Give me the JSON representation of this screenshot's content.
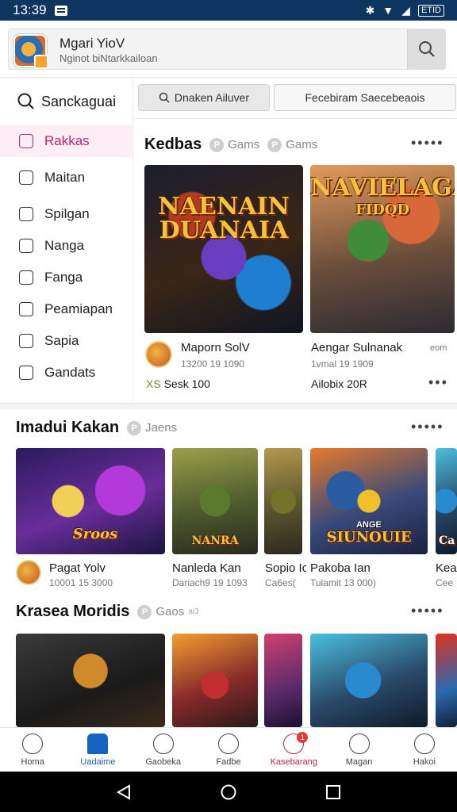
{
  "status_bar": {
    "time": "13:39",
    "battery": "ETID"
  },
  "header": {
    "title": "Mgari YioV",
    "subtitle": "Nginot biNtarkkailoan",
    "search_icon": "search-icon"
  },
  "sidebar": {
    "search_label": "Sanckaguai",
    "items": [
      {
        "label": "Rakkas",
        "icon": "thumb-icon",
        "active": true
      },
      {
        "label": "Maitan",
        "icon": "thumb-icon"
      },
      {
        "label": "Spilgan",
        "icon": "edit-icon"
      },
      {
        "label": "Nanga",
        "icon": "calendar-icon"
      },
      {
        "label": "Fanga",
        "icon": "note-icon"
      },
      {
        "label": "Peamiapan",
        "icon": "person-icon"
      },
      {
        "label": "Sapia",
        "icon": "chat-icon"
      },
      {
        "label": "Gandats",
        "icon": "settings-icon"
      }
    ]
  },
  "filters": {
    "chip1": "Dnaken Ailuver",
    "chip2": "Fecebiram Saecebeaois"
  },
  "section1": {
    "title": "Kedbas",
    "tag1": "Gams",
    "tag2": "Gams",
    "cards": [
      {
        "art_title": "NAENAIN DUANAIA",
        "name": "Maporn SolV",
        "meta": "13200 19 1090",
        "stat": "Sesk 100",
        "stat_prefix": "XS"
      },
      {
        "art_title": "NAVIELAGA",
        "art_sub": "FIDQD",
        "name": "Aengar Sulnanak",
        "meta": "1vmal 19 1909",
        "stat": "Ailobix 20R",
        "extra": "eom"
      }
    ]
  },
  "section2": {
    "title": "Imadui Kakan",
    "tag": "Jaens",
    "cards": [
      {
        "art_title": "Sroos",
        "name": "Pagat Yolv",
        "meta": "10001 15 3000"
      },
      {
        "art_title": "NANRA",
        "name": "Nanleda Kan",
        "meta": "Dariach9 19 1093"
      },
      {
        "name": "Sopio Ic",
        "meta": "Ca6es("
      },
      {
        "art_title": "SIUNOUIE",
        "art_sub": "ANGE",
        "name": "Pakoba Ian",
        "meta": "Tulamit 13 000)"
      },
      {
        "art_title": "Ca",
        "name": "Kea",
        "meta": "Cee"
      }
    ]
  },
  "section3": {
    "title": "Krasea Moridis",
    "tag": "Gaos",
    "tag_extra": "ai3"
  },
  "bottom_nav": [
    {
      "label": "Homa",
      "icon": "home-icon"
    },
    {
      "label": "Uadaime",
      "icon": "bookmark-icon",
      "active": true
    },
    {
      "label": "Gaobeka",
      "icon": "social-icon"
    },
    {
      "label": "Fadbe",
      "icon": "compass-icon"
    },
    {
      "label": "Kasebarang",
      "icon": "chat-icon",
      "alert": true,
      "badge": "1"
    },
    {
      "label": "Magan",
      "icon": "clock-icon"
    },
    {
      "label": "Hakoi",
      "icon": "profile-icon"
    }
  ]
}
